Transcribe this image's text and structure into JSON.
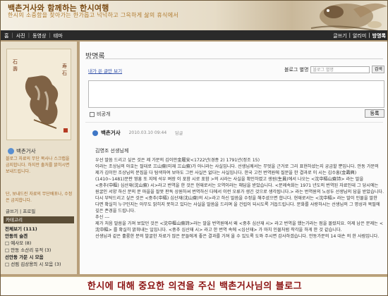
{
  "banner": {
    "title": "백촌거사와 함께하는 한시여행",
    "subtitle": "한시의 소중함을 찾아가는 한가롭고 넉넉하고 그윽하게 삶의 휴식에서"
  },
  "menu": {
    "left": [
      "홈",
      "사진",
      "동영상",
      "테마"
    ],
    "right": [
      "글쓰기",
      "알리미",
      "방명록"
    ],
    "current": "방명록"
  },
  "sidebar": {
    "profile_name": "백촌거사",
    "desc1": "블로그 자료의 무단 복사나 스크랩을 금지합니다. 하지만 출처를 밝히시면 보내드립니다.",
    "desc2": "단, 보내드린 자료의 무단배포나, 수정은 금지합니다.",
    "write_label": "글쓰기 | 프로필",
    "category_header": "카테고리",
    "categories": [
      {
        "label": "전체보기 (111)",
        "bold": true
      },
      {
        "label": "안동의 슬겐",
        "bold": true
      },
      {
        "label": "□ 예사모 (8)",
        "bold": false
      },
      {
        "label": "□ 안동 소산리 유적 (3)",
        "bold": false
      },
      {
        "label": "선안동 가문 시 모음",
        "bold": true
      },
      {
        "label": "□ 선림 김상용의 시 모음 (3)",
        "bold": false
      }
    ]
  },
  "main": {
    "page_title": "방명록",
    "my_posts_link": "내가 쓴 글만 보기",
    "search_label": "블로그 별명",
    "search_placeholder": "블로그 별명",
    "search_button": "검색",
    "secret_label": "비공개",
    "submit_label": "등록",
    "entry_name": "백촌거사",
    "entry_date": "2010.03.10 09:44",
    "entry_reply": "답글",
    "greeting": "김영조 선생님께",
    "paragraphs": [
      "우선 말씀 드리고 싶은 것은 제 가문의 김이안金履安<1722년(경종 2) 1791년(정조 15)",
      "이라는 조상님의 아호는 절대로 三山齋(미재 三山齋)가 아니라는 사실입니다. 선생님께서는 무엇을 근거로 그리 표현하셨는지 궁금할 뿐입니다. 안동 가문의 제가 김이안 조상님의 문집을 다 탐색하여 보아도 그런 사실은 없다는 사실입니다. 한국 고전 번역원에 질문을 한 결과로 이 시는 김수흥(金壽興)(1410~1481)문판 영흥 또 지에 석우 벼장 이 포함 시로 포함 >의 시라는 사실을 확인하였고 생원(生員)에서 나오는 <沈中樞山齋詩> 라는 말을",
      "<중추(中樞) 심산재(沈山齋) 시>라고 번역을 한 것은 현재로서는 오역이라는 해답을 받았습니다. <문제속화는 1971 년도의 번역된 자료인데 그 당시에는 원굴인 서양 하신 분의 문 마을을 잘못 판독 상원하셔 번역하신 다에서 이런 오류가 생긴 것으로 생각됩니다.> 라는 번역원의 노성두 선생님의 답을 받았습니다.",
      "다시 부탁드리고 싶은 것은 <중추(中樞) 심산재(沈山齋)의 시>라고 하신 말씀을 수정을 해주셨으면 합니다. 현재로서는 <沈中樞> 라는 말이 인물을 말한 다면 확실히 누구인지는 아무도 밝히지 못하고 있다는 사실을 말씀을 드리며 을 건립이 되시도록 거듭드립니다. 문화를 사랑하시는 선생님의 그 명성과 목필에 깊은 존경을 드립니다.",
      "추신 ---",
      "제가 처음 말씀을 가져 보았던 것은 <沈中樞山齋詩>라는 말을 번역원에서 왜 <중추 심산재 시> 라고 번역을 했는가라는 점을 몰랐지요. 이제 남은 문제는 <沈中樞> 를 확실히 밝혀내는 일입니다. <중추 심산재 시> 라고 한 번역 속에 <심산재> 가 마치 인물처럼 착각을 하게 한 것 같습니다.",
      "선생님과 같은 훌륭한 분의 발굴한 자료가 많은 분들에게 좋은 결과를 가져 올 수 있도록 도와 주시면 감사하겠습니다. 안동가문의 14 대손 의 한 사람입니다."
    ]
  },
  "caption": "한시에 대해 중요한 의견을 주신 백촌거사님의 블로그"
}
